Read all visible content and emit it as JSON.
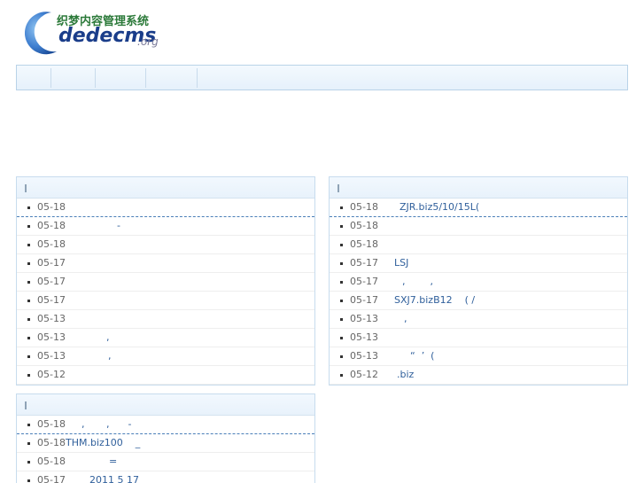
{
  "logo": {
    "cn": "织梦内容管理系统",
    "en": "dedecms",
    "org": ".org"
  },
  "nav": {
    "items": [
      "",
      "",
      "",
      ""
    ]
  },
  "panels": [
    {
      "title": "",
      "items": [
        {
          "date": "05-18",
          "title": ""
        },
        {
          "date": "05-18",
          "title": "-"
        },
        {
          "date": "05-18",
          "title": ""
        },
        {
          "date": "05-17",
          "title": ""
        },
        {
          "date": "05-17",
          "title": ""
        },
        {
          "date": "05-17",
          "title": ""
        },
        {
          "date": "05-13",
          "title": ""
        },
        {
          "date": "05-13",
          "title": ","
        },
        {
          "date": "05-13",
          "title": ","
        },
        {
          "date": "05-12",
          "title": ""
        }
      ]
    },
    {
      "title": "",
      "items": [
        {
          "date": "05-18",
          "title": "ZJR.biz5/10/15L("
        },
        {
          "date": "05-18",
          "title": ""
        },
        {
          "date": "05-18",
          "title": ""
        },
        {
          "date": "05-17",
          "title": "LSJ"
        },
        {
          "date": "05-17",
          "title": ",        ,"
        },
        {
          "date": "05-17",
          "title": "SXJ7.bizB12    ( /"
        },
        {
          "date": "05-13",
          "title": ","
        },
        {
          "date": "05-13",
          "title": ""
        },
        {
          "date": "05-13",
          "title": "“  ’  ("
        },
        {
          "date": "05-12",
          "title": ".biz"
        }
      ]
    },
    {
      "title": "",
      "items": [
        {
          "date": "05-18",
          "title": ",       ,      -"
        },
        {
          "date": "05-18",
          "title": "THM.biz100    _"
        },
        {
          "date": "05-18",
          "title": "="
        },
        {
          "date": "05-17",
          "title": "2011 5 17"
        }
      ]
    }
  ]
}
